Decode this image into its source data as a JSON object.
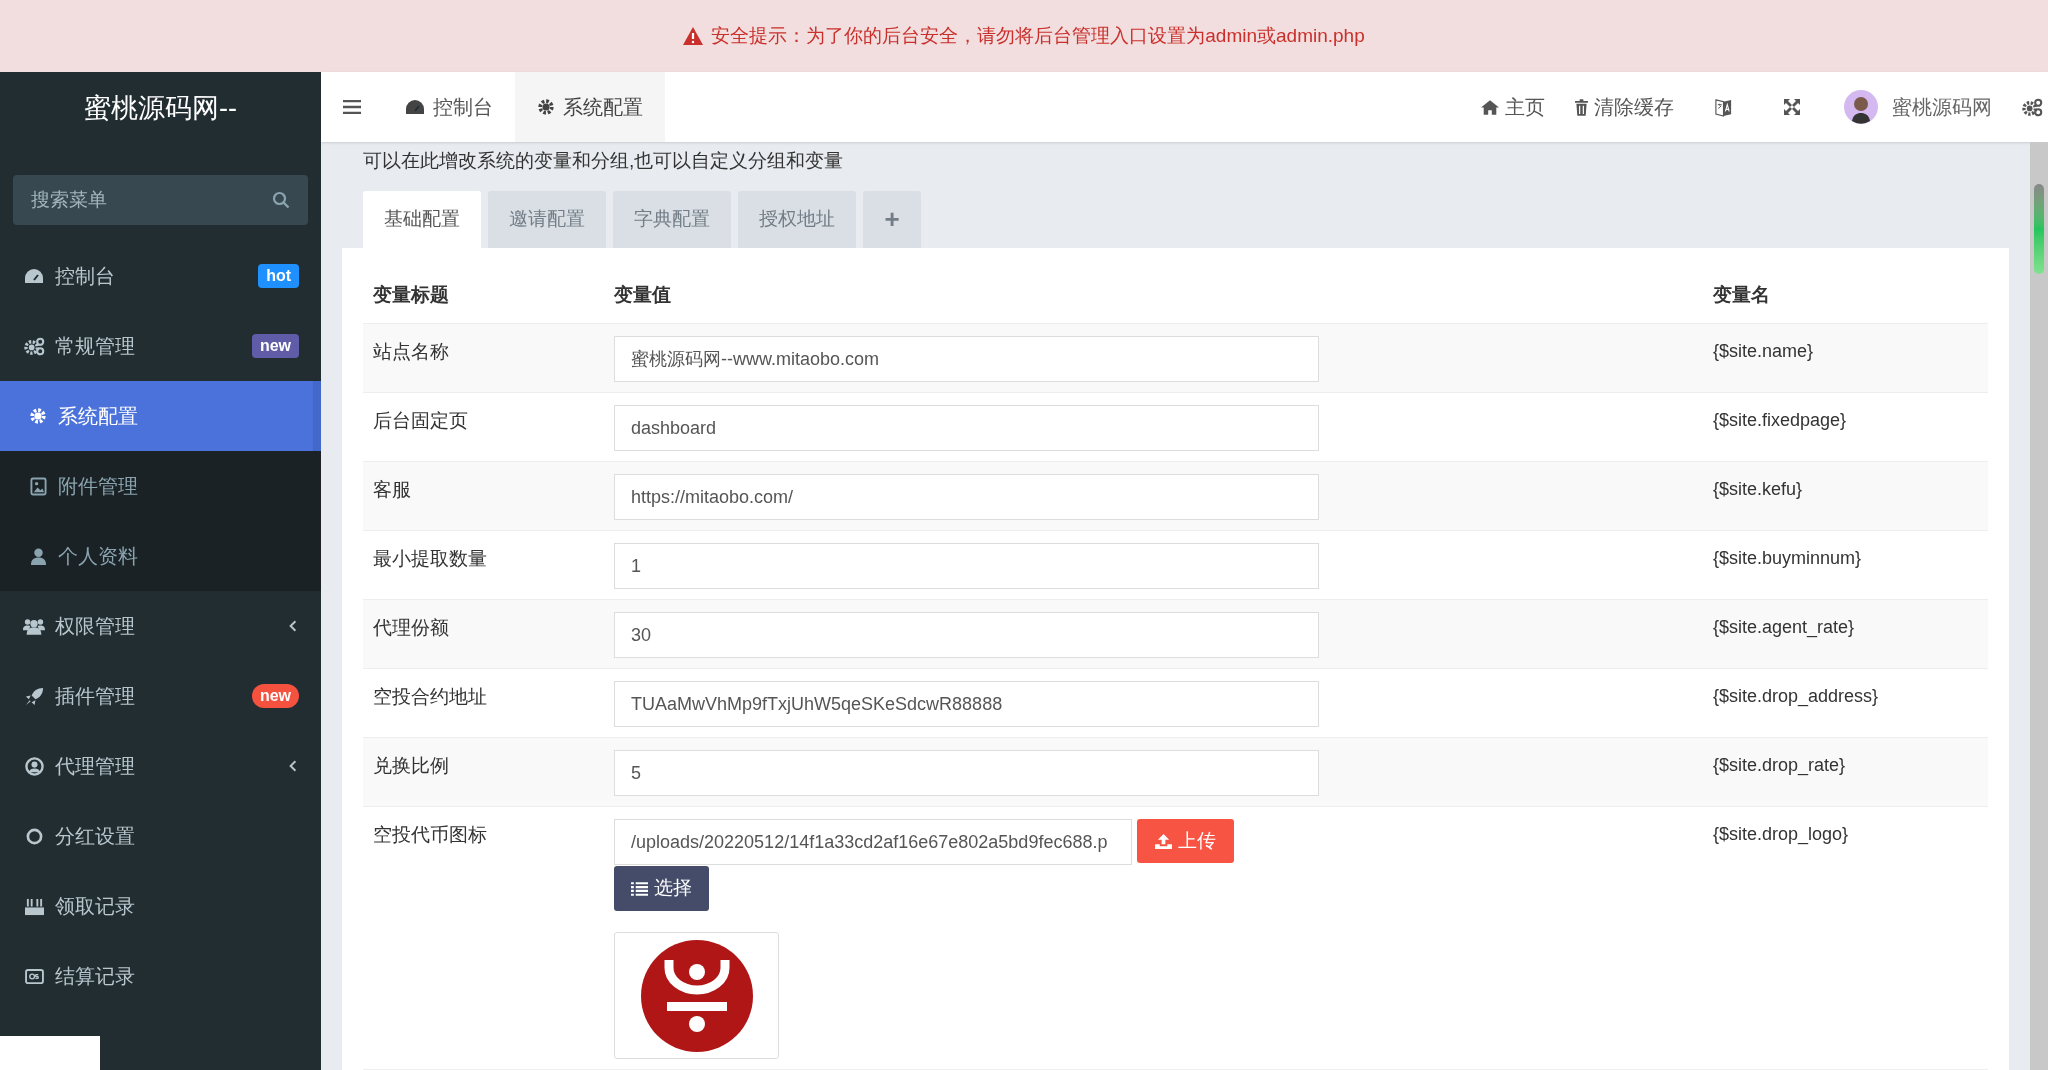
{
  "alert": {
    "text": "安全提示：为了你的后台安全，请勿将后台管理入口设置为admin或admin.php"
  },
  "sidebar": {
    "logo": "蜜桃源码网--",
    "search": {
      "placeholder": "搜索菜单"
    },
    "items": [
      {
        "kind": "item",
        "label": "控制台",
        "badge": "hot",
        "color": "#1e90ff",
        "selected": false
      },
      {
        "kind": "group",
        "label": "常规管理",
        "badge": "new",
        "color": "#605ca8",
        "expanded": true,
        "selected": false,
        "children": [
          {
            "label": "系统配置",
            "selected": true
          },
          {
            "label": "附件管理",
            "selected": false
          },
          {
            "label": "个人资料",
            "selected": false
          }
        ]
      },
      {
        "kind": "group",
        "label": "权限管理",
        "expanded": false,
        "selected": false
      },
      {
        "kind": "item",
        "label": "插件管理",
        "badge": "new",
        "color": "#f4513e",
        "selected": false
      },
      {
        "kind": "group",
        "label": "代理管理",
        "expanded": false,
        "selected": false
      },
      {
        "kind": "item",
        "label": "分红设置",
        "selected": false
      },
      {
        "kind": "item",
        "label": "领取记录",
        "selected": false
      },
      {
        "kind": "item",
        "label": "结算记录",
        "selected": false
      }
    ]
  },
  "topbar": {
    "tabs": [
      {
        "label": "控制台",
        "selected": false
      },
      {
        "label": "系统配置",
        "selected": true
      }
    ],
    "actions": [
      {
        "kind": "link",
        "label": "主页"
      },
      {
        "kind": "link",
        "label": "清除缓存"
      },
      {
        "kind": "translate"
      },
      {
        "kind": "fullscreen"
      },
      {
        "kind": "user",
        "label": "蜜桃源码网"
      },
      {
        "kind": "settings"
      }
    ]
  },
  "description": "可以在此增改系统的变量和分组,也可以自定义分组和变量",
  "config_tabs": [
    {
      "label": "基础配置",
      "selected": true
    },
    {
      "label": "邀请配置",
      "selected": false
    },
    {
      "label": "字典配置",
      "selected": false
    },
    {
      "label": "授权地址",
      "selected": false
    },
    {
      "label": "+",
      "selected": false
    }
  ],
  "table": {
    "columns": [
      "变量标题",
      "变量值",
      "变量名"
    ],
    "rows": [
      {
        "kind": "text",
        "title": "站点名称",
        "value": "蜜桃源码网--www.mitaobo.com",
        "name": "{$site.name}"
      },
      {
        "kind": "text",
        "title": "后台固定页",
        "value": "dashboard",
        "name": "{$site.fixedpage}"
      },
      {
        "kind": "text",
        "title": "客服",
        "value": "https://mitaobo.com/",
        "name": "{$site.kefu}"
      },
      {
        "kind": "text",
        "title": "最小提取数量",
        "value": "1",
        "name": "{$site.buyminnum}"
      },
      {
        "kind": "text",
        "title": "代理份额",
        "value": "30",
        "name": "{$site.agent_rate}"
      },
      {
        "kind": "text",
        "title": "空投合约地址",
        "value": "TUAaMwVhMp9fTxjUhW5qeSKeSdcwR88888",
        "name": "{$site.drop_address}"
      },
      {
        "kind": "text",
        "title": "兑换比例",
        "value": "5",
        "name": "{$site.drop_rate}"
      },
      {
        "kind": "image",
        "title": "空投代币图标",
        "value": "/uploads/20220512/14f1a33cd2af16e67e802a5bd9fec688.p",
        "name": "{$site.drop_logo}",
        "upload": "上传",
        "choose": "选择"
      }
    ]
  }
}
